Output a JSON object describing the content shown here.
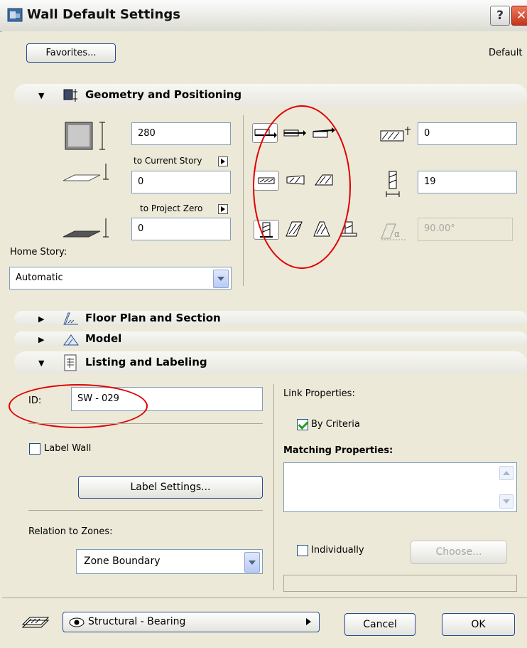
{
  "window": {
    "title": "Wall Default Settings",
    "help_label": "?",
    "close_label": "✕"
  },
  "header": {
    "favorites_label": "Favorites...",
    "default_label": "Default"
  },
  "sections": {
    "geometry": "Geometry and Positioning",
    "floorplan": "Floor Plan and Section",
    "model": "Model",
    "listing": "Listing and Labeling"
  },
  "geometry": {
    "height_value": "280",
    "to_current_story_label": "to Current Story",
    "base_offset_value": "0",
    "to_project_zero_label": "to Project Zero",
    "project_offset_value": "0",
    "home_story_label": "Home Story:",
    "home_story_value": "Automatic",
    "ref_line_offset_value": "0",
    "thickness_value": "19",
    "angle_value": "90.00°"
  },
  "listing": {
    "id_label": "ID:",
    "id_value": "SW - 029",
    "label_wall_label": "Label Wall",
    "label_settings_label": "Label Settings...",
    "relation_label": "Relation to Zones:",
    "relation_value": "Zone Boundary",
    "link_properties_label": "Link Properties:",
    "by_criteria_label": "By Criteria",
    "matching_label": "Matching Properties:",
    "individually_label": "Individually",
    "choose_label": "Choose..."
  },
  "footer": {
    "layer_value": "Structural - Bearing",
    "cancel_label": "Cancel",
    "ok_label": "OK"
  },
  "colors": {
    "highlight_ellipse": "#e00000",
    "dialog_bg": "#ece9d8",
    "checkbox_check": "#21a121"
  },
  "icons": [
    "wall-tool-icon",
    "geometry-icon",
    "floor-plan-icon",
    "model-icon",
    "listing-icon",
    "layer-icon",
    "eye-icon"
  ]
}
